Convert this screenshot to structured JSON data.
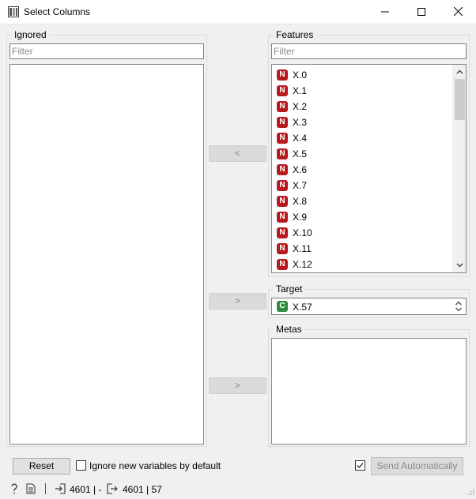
{
  "window": {
    "title": "Select Columns"
  },
  "ignored": {
    "title": "Ignored",
    "filter_placeholder": "Filter"
  },
  "features": {
    "title": "Features",
    "filter_placeholder": "Filter",
    "items": [
      {
        "type": "N",
        "label": "X.0"
      },
      {
        "type": "N",
        "label": "X.1"
      },
      {
        "type": "N",
        "label": "X.2"
      },
      {
        "type": "N",
        "label": "X.3"
      },
      {
        "type": "N",
        "label": "X.4"
      },
      {
        "type": "N",
        "label": "X.5"
      },
      {
        "type": "N",
        "label": "X.6"
      },
      {
        "type": "N",
        "label": "X.7"
      },
      {
        "type": "N",
        "label": "X.8"
      },
      {
        "type": "N",
        "label": "X.9"
      },
      {
        "type": "N",
        "label": "X.10"
      },
      {
        "type": "N",
        "label": "X.11"
      },
      {
        "type": "N",
        "label": "X.12"
      }
    ]
  },
  "buttons": {
    "move_to_ignored": "<",
    "move_to_target": ">",
    "move_to_metas": ">"
  },
  "target": {
    "title": "Target",
    "selected": {
      "type": "C",
      "label": "X.57"
    }
  },
  "metas": {
    "title": "Metas"
  },
  "footer": {
    "reset": "Reset",
    "ignore_new_label": "Ignore new variables by default",
    "send_auto": "Send Automatically"
  },
  "status": {
    "input_summary": "4601 | -",
    "output_summary": "4601 | 57"
  },
  "colors": {
    "numeric_badge": "#b7191f",
    "categorical_badge": "#2e8b3c"
  }
}
